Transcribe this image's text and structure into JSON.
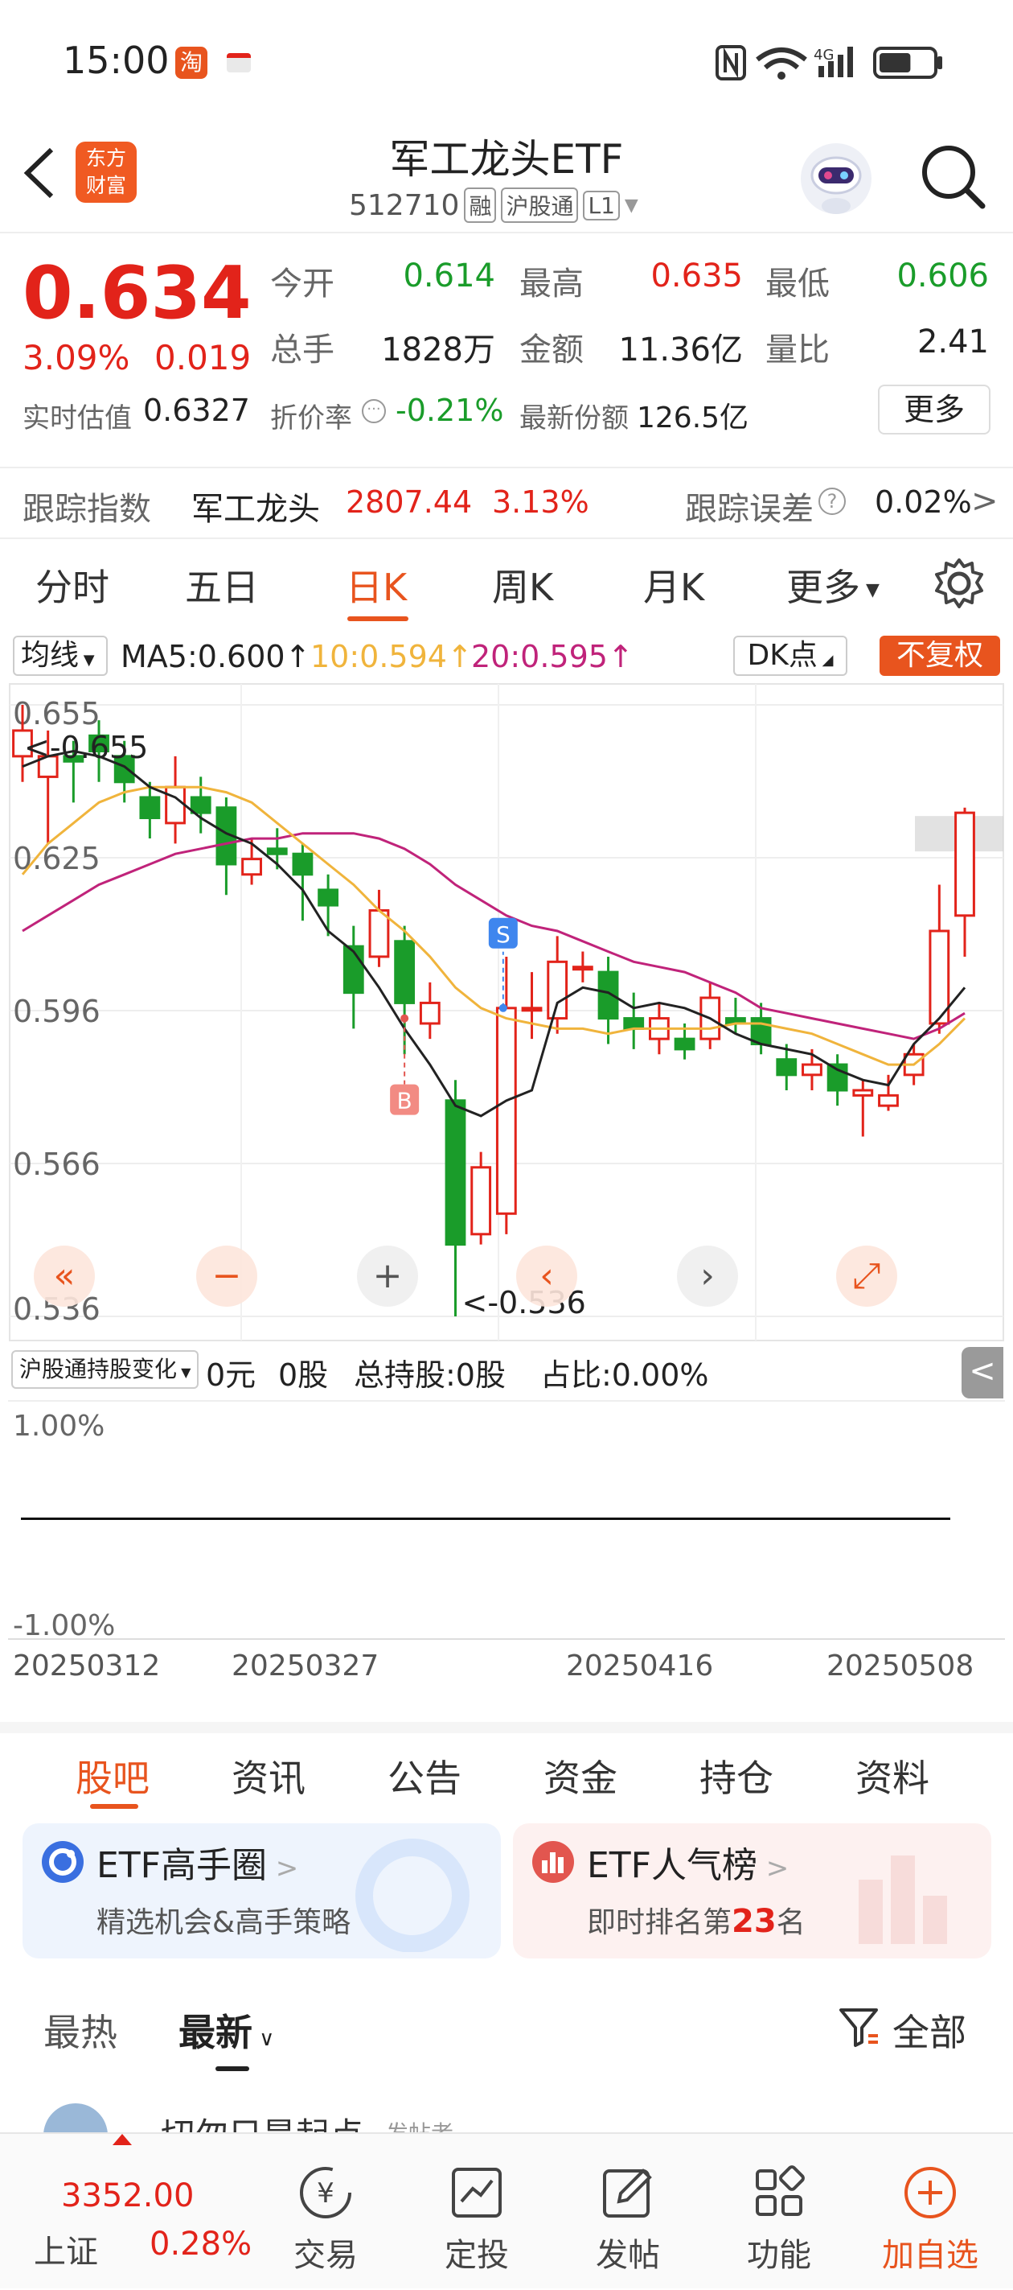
{
  "status_bar": {
    "time": "15:00",
    "battery_level": 0.6
  },
  "header": {
    "title": "军工龙头ETF",
    "code": "512710",
    "tag_margin": "融",
    "tag_connect": "沪股通",
    "tag_level": "L1",
    "logo_line1": "东方",
    "logo_line2": "财富"
  },
  "quote": {
    "price": "0.634",
    "change_pct": "3.09%",
    "change": "0.019",
    "open_label": "今开",
    "open": "0.614",
    "high_label": "最高",
    "high": "0.635",
    "low_label": "最低",
    "low": "0.606",
    "volume_label": "总手",
    "volume": "1828万",
    "amount_label": "金额",
    "amount": "11.36亿",
    "ratio_label": "量比",
    "ratio": "2.41",
    "iopv_label": "实时估值",
    "iopv": "0.6327",
    "discount_label": "折价率",
    "discount": "-0.21%",
    "shares_label": "最新份额",
    "shares": "126.5亿",
    "more_label": "更多"
  },
  "tracking": {
    "label": "跟踪指数",
    "index_name": "军工龙头",
    "index_value": "2807.44",
    "index_pct": "3.13%",
    "error_label": "跟踪误差",
    "error_value": "0.02%"
  },
  "chart_tabs": [
    "分时",
    "五日",
    "日K",
    "周K",
    "月K",
    "更多"
  ],
  "active_tab": "日K",
  "indicators": {
    "type_label": "均线",
    "ma5": "MA5:0.600↑",
    "ma10": "10:0.594↑",
    "ma20": "20:0.595↑",
    "dk_label": "DK点",
    "adjust_label": "不复权"
  },
  "colors": {
    "up": "#e2231a",
    "down": "#1a9c2a",
    "accent": "#e8541e",
    "ma5": "#222222",
    "ma10": "#f0b43c",
    "ma20": "#c0237a"
  },
  "chart_data": {
    "type": "candlestick",
    "y_ticks": [
      "0.655",
      "0.625",
      "0.596",
      "0.566",
      "0.536"
    ],
    "ylim": [
      0.536,
      0.655
    ],
    "max_marker": "<-0.655",
    "min_marker": "<-0.536",
    "x_ticks": [
      "20250312",
      "20250327",
      "20250416",
      "20250508"
    ],
    "signals": [
      {
        "label": "S",
        "price": 0.596
      },
      {
        "label": "B",
        "price": 0.594
      }
    ],
    "candles": [
      {
        "o": 0.645,
        "c": 0.65,
        "h": 0.655,
        "l": 0.64
      },
      {
        "o": 0.641,
        "c": 0.645,
        "h": 0.65,
        "l": 0.628
      },
      {
        "o": 0.645,
        "c": 0.644,
        "h": 0.648,
        "l": 0.636
      },
      {
        "o": 0.649,
        "c": 0.646,
        "h": 0.652,
        "l": 0.64
      },
      {
        "o": 0.645,
        "c": 0.64,
        "h": 0.648,
        "l": 0.636
      },
      {
        "o": 0.637,
        "c": 0.633,
        "h": 0.64,
        "l": 0.629
      },
      {
        "o": 0.632,
        "c": 0.639,
        "h": 0.645,
        "l": 0.628
      },
      {
        "o": 0.637,
        "c": 0.634,
        "h": 0.641,
        "l": 0.63
      },
      {
        "o": 0.635,
        "c": 0.624,
        "h": 0.637,
        "l": 0.618
      },
      {
        "o": 0.622,
        "c": 0.625,
        "h": 0.629,
        "l": 0.62
      },
      {
        "o": 0.627,
        "c": 0.626,
        "h": 0.631,
        "l": 0.623
      },
      {
        "o": 0.626,
        "c": 0.622,
        "h": 0.628,
        "l": 0.613
      },
      {
        "o": 0.619,
        "c": 0.616,
        "h": 0.622,
        "l": 0.61
      },
      {
        "o": 0.608,
        "c": 0.599,
        "h": 0.612,
        "l": 0.592
      },
      {
        "o": 0.606,
        "c": 0.615,
        "h": 0.619,
        "l": 0.604
      },
      {
        "o": 0.609,
        "c": 0.597,
        "h": 0.612,
        "l": 0.587
      },
      {
        "o": 0.593,
        "c": 0.597,
        "h": 0.601,
        "l": 0.59
      },
      {
        "o": 0.578,
        "c": 0.55,
        "h": 0.582,
        "l": 0.536
      },
      {
        "o": 0.552,
        "c": 0.565,
        "h": 0.568,
        "l": 0.55
      },
      {
        "o": 0.556,
        "c": 0.596,
        "h": 0.606,
        "l": 0.552
      },
      {
        "o": 0.596,
        "c": 0.596,
        "h": 0.603,
        "l": 0.59
      },
      {
        "o": 0.594,
        "c": 0.605,
        "h": 0.61,
        "l": 0.591
      },
      {
        "o": 0.604,
        "c": 0.604,
        "h": 0.607,
        "l": 0.601
      },
      {
        "o": 0.603,
        "c": 0.594,
        "h": 0.606,
        "l": 0.589
      },
      {
        "o": 0.594,
        "c": 0.592,
        "h": 0.599,
        "l": 0.588
      },
      {
        "o": 0.59,
        "c": 0.594,
        "h": 0.597,
        "l": 0.587
      },
      {
        "o": 0.59,
        "c": 0.588,
        "h": 0.593,
        "l": 0.586
      },
      {
        "o": 0.59,
        "c": 0.598,
        "h": 0.601,
        "l": 0.588
      },
      {
        "o": 0.594,
        "c": 0.593,
        "h": 0.598,
        "l": 0.591
      },
      {
        "o": 0.594,
        "c": 0.589,
        "h": 0.597,
        "l": 0.587
      },
      {
        "o": 0.586,
        "c": 0.583,
        "h": 0.589,
        "l": 0.58
      },
      {
        "o": 0.583,
        "c": 0.585,
        "h": 0.588,
        "l": 0.58
      },
      {
        "o": 0.585,
        "c": 0.58,
        "h": 0.587,
        "l": 0.577
      },
      {
        "o": 0.579,
        "c": 0.58,
        "h": 0.582,
        "l": 0.571
      },
      {
        "o": 0.577,
        "c": 0.579,
        "h": 0.583,
        "l": 0.576
      },
      {
        "o": 0.583,
        "c": 0.587,
        "h": 0.589,
        "l": 0.581
      },
      {
        "o": 0.593,
        "c": 0.611,
        "h": 0.62,
        "l": 0.591
      },
      {
        "o": 0.614,
        "c": 0.634,
        "h": 0.635,
        "l": 0.606
      }
    ],
    "ma5": [
      0.643,
      0.645,
      0.646,
      0.645,
      0.643,
      0.639,
      0.637,
      0.633,
      0.63,
      0.628,
      0.624,
      0.619,
      0.611,
      0.607,
      0.6,
      0.592,
      0.585,
      0.577,
      0.575,
      0.578,
      0.58,
      0.597,
      0.6,
      0.599,
      0.596,
      0.597,
      0.596,
      0.594,
      0.591,
      0.589,
      0.588,
      0.587,
      0.584,
      0.582,
      0.581,
      0.589,
      0.594,
      0.6
    ],
    "ma10": [
      0.622,
      0.628,
      0.632,
      0.636,
      0.638,
      0.639,
      0.639,
      0.639,
      0.638,
      0.636,
      0.632,
      0.628,
      0.624,
      0.62,
      0.615,
      0.611,
      0.606,
      0.6,
      0.596,
      0.594,
      0.593,
      0.592,
      0.592,
      0.591,
      0.592,
      0.592,
      0.592,
      0.592,
      0.593,
      0.593,
      0.592,
      0.591,
      0.589,
      0.587,
      0.585,
      0.585,
      0.589,
      0.594
    ],
    "ma20": [
      0.611,
      0.614,
      0.617,
      0.62,
      0.622,
      0.624,
      0.626,
      0.627,
      0.628,
      0.629,
      0.629,
      0.63,
      0.63,
      0.63,
      0.629,
      0.627,
      0.624,
      0.62,
      0.617,
      0.614,
      0.612,
      0.611,
      0.609,
      0.607,
      0.605,
      0.604,
      0.603,
      0.601,
      0.599,
      0.596,
      0.595,
      0.594,
      0.593,
      0.592,
      0.591,
      0.59,
      0.592,
      0.595
    ]
  },
  "subchart": {
    "selector_label": "沪股通持股变化",
    "amount": "0元",
    "volume": "0股",
    "total": "总持股:0股",
    "ratio": "占比:0.00%",
    "y_max": "1.00%",
    "y_min": "-1.00%",
    "value": 0.0
  },
  "bottom_tabs": [
    "股吧",
    "资讯",
    "公告",
    "资金",
    "持仓",
    "资料"
  ],
  "active_bottom_tab": "股吧",
  "cards": {
    "left": {
      "title": "ETF高手圈",
      "subtitle": "精选机会&高手策略"
    },
    "right": {
      "title": "ETF人气榜",
      "subtitle_prefix": "即时排名第",
      "rank": "23",
      "subtitle_suffix": "名"
    }
  },
  "sorts": {
    "hot": "最热",
    "latest": "最新",
    "filter": "全部"
  },
  "post_preview": {
    "author": "切勿只是起点",
    "meta": "发帖者"
  },
  "index_ticker": {
    "value": "3352.00",
    "name": "上证",
    "pct": "0.28%"
  },
  "nav": [
    "交易",
    "定投",
    "发帖",
    "功能",
    "加自选"
  ]
}
